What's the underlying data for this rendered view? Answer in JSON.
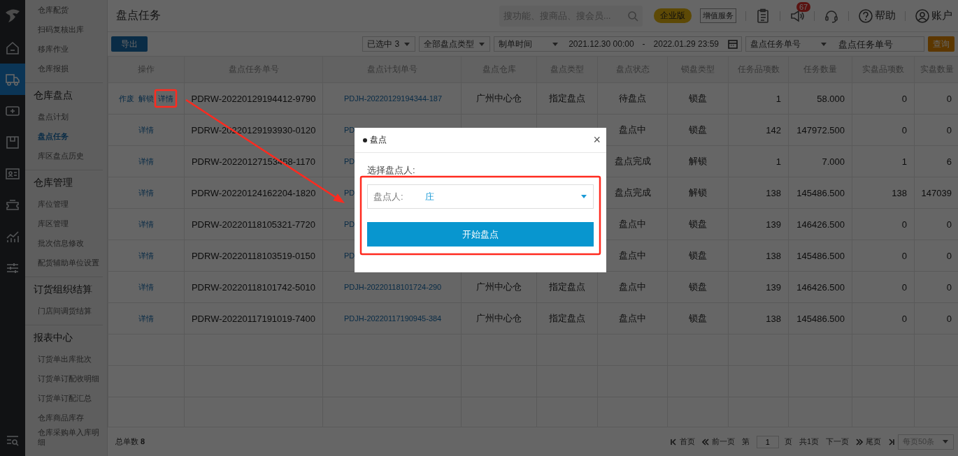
{
  "rail": {
    "items": [
      {
        "selected": false
      },
      {
        "selected": true
      },
      {
        "selected": false
      },
      {
        "selected": false
      },
      {
        "selected": false
      },
      {
        "selected": false
      },
      {
        "selected": false
      },
      {
        "selected": false
      }
    ]
  },
  "sidebar": {
    "groups": [
      {
        "items": [
          {
            "label": "仓库配货",
            "selected": false
          },
          {
            "label": "扫码复核出库",
            "selected": false
          },
          {
            "label": "移库作业",
            "selected": false
          },
          {
            "label": "仓库报损",
            "selected": false
          }
        ]
      },
      {
        "title": "仓库盘点",
        "items": [
          {
            "label": "盘点计划",
            "selected": false
          },
          {
            "label": "盘点任务",
            "selected": true
          },
          {
            "label": "库区盘点历史",
            "selected": false
          }
        ]
      },
      {
        "title": "仓库管理",
        "items": [
          {
            "label": "库位管理",
            "selected": false
          },
          {
            "label": "库区管理",
            "selected": false
          },
          {
            "label": "批次信息修改",
            "selected": false
          },
          {
            "label": "配货辅助单位设置",
            "selected": false
          }
        ]
      },
      {
        "title": "订货组织结算",
        "items": [
          {
            "label": "门店间调货结算",
            "selected": false
          }
        ]
      },
      {
        "title": "报表中心",
        "items": [
          {
            "label": "订货单出库批次",
            "selected": false
          },
          {
            "label": "订货单订配收明细",
            "selected": false
          },
          {
            "label": "订货单订配汇总",
            "selected": false
          },
          {
            "label": "仓库商品库存",
            "selected": false
          },
          {
            "label": "仓库采购单入库明细",
            "selected": false
          }
        ]
      }
    ]
  },
  "header": {
    "title": "盘点任务",
    "search": {
      "placeholder": "搜功能、搜商品、搜会员..."
    },
    "edition_badge": "企业版",
    "service_button": "增值服务",
    "notification_count": "67",
    "help": "帮助",
    "account": "账户"
  },
  "toolbar": {
    "export_button": "导出",
    "filters": [
      {
        "value": "已选中 3"
      },
      {
        "value": "全部盘点类型"
      }
    ],
    "date_field": {
      "type": "制单时间",
      "start": "2021.12.30 00:00",
      "separator": "-",
      "end": "2022.01.29 23:59"
    },
    "search_field": {
      "type": "盘点任务单号",
      "placeholder": "盘点任务单号"
    },
    "query_button": "查询"
  },
  "table": {
    "columns": [
      "操作",
      "盘点任务单号",
      "盘点计划单号",
      "盘点仓库",
      "盘点类型",
      "盘点状态",
      "锁盘类型",
      "任务品项数",
      "任务数量",
      "实盘品项数",
      "实盘数量"
    ],
    "rows": [
      {
        "actions": [
          "作废",
          "解锁",
          "详情"
        ],
        "task_no": "PDRW-20220129194412-9790",
        "plan_no": "PDJH-20220129194344-187",
        "warehouse": "广州中心仓",
        "type": "指定盘点",
        "status": "待盘点",
        "lock_type": "锁盘",
        "task_items": "1",
        "task_qty": "58.000",
        "actual_items": "0",
        "actual_qty": "0"
      },
      {
        "actions": [
          "详情"
        ],
        "task_no": "PDRW-20220129193930-0120",
        "plan_no": "PD",
        "status": "盘点中",
        "lock_type": "锁盘",
        "task_items": "142",
        "task_qty": "147972.500",
        "actual_items": "0",
        "actual_qty": "0"
      },
      {
        "actions": [
          "详情"
        ],
        "task_no": "PDRW-20220127153458-1170",
        "plan_no": "PD",
        "status": "盘点完成",
        "lock_type": "解锁",
        "task_items": "1",
        "task_qty": "7.000",
        "actual_items": "1",
        "actual_qty": "6"
      },
      {
        "actions": [
          "详情"
        ],
        "task_no": "PDRW-20220124162204-1820",
        "plan_no": "PD",
        "status": "盘点完成",
        "lock_type": "解锁",
        "task_items": "138",
        "task_qty": "145486.500",
        "actual_items": "138",
        "actual_qty": "147039"
      },
      {
        "actions": [
          "详情"
        ],
        "task_no": "PDRW-20220118105321-7720",
        "plan_no": "PD",
        "status": "盘点中",
        "lock_type": "锁盘",
        "task_items": "139",
        "task_qty": "146426.500",
        "actual_items": "0",
        "actual_qty": "0"
      },
      {
        "actions": [
          "详情"
        ],
        "task_no": "PDRW-20220118103519-0150",
        "plan_no": "PD",
        "status": "盘点中",
        "lock_type": "锁盘",
        "task_items": "138",
        "task_qty": "145486.500",
        "actual_items": "0",
        "actual_qty": "0"
      },
      {
        "actions": [
          "详情"
        ],
        "task_no": "PDRW-20220118101742-5010",
        "plan_no": "PDJH-20220118101724-290",
        "warehouse": "广州中心仓",
        "type": "指定盘点",
        "status": "盘点中",
        "lock_type": "锁盘",
        "task_items": "139",
        "task_qty": "146426.500",
        "actual_items": "0",
        "actual_qty": "0"
      },
      {
        "actions": [
          "详情"
        ],
        "task_no": "PDRW-20220117191019-7400",
        "plan_no": "PDJH-20220117190945-384",
        "warehouse": "广州中心仓",
        "type": "指定盘点",
        "status": "盘点中",
        "lock_type": "锁盘",
        "task_items": "138",
        "task_qty": "145486.500",
        "actual_items": "0",
        "actual_qty": "0"
      }
    ]
  },
  "footer": {
    "total": "总单数 **8**",
    "pager": {
      "first": "首页",
      "prev": "前一页",
      "page_prefix": "第",
      "page": "1",
      "page_suffix": "页",
      "total_pages": "共1页",
      "next": "下一页",
      "last": "尾页",
      "page_size": "每页50条"
    }
  },
  "dialog": {
    "title": "盘点",
    "close": "×",
    "prompt": "选择盘点人:",
    "field_label": "盘点人:",
    "field_value": "庄",
    "start_button": "开始盘点"
  }
}
